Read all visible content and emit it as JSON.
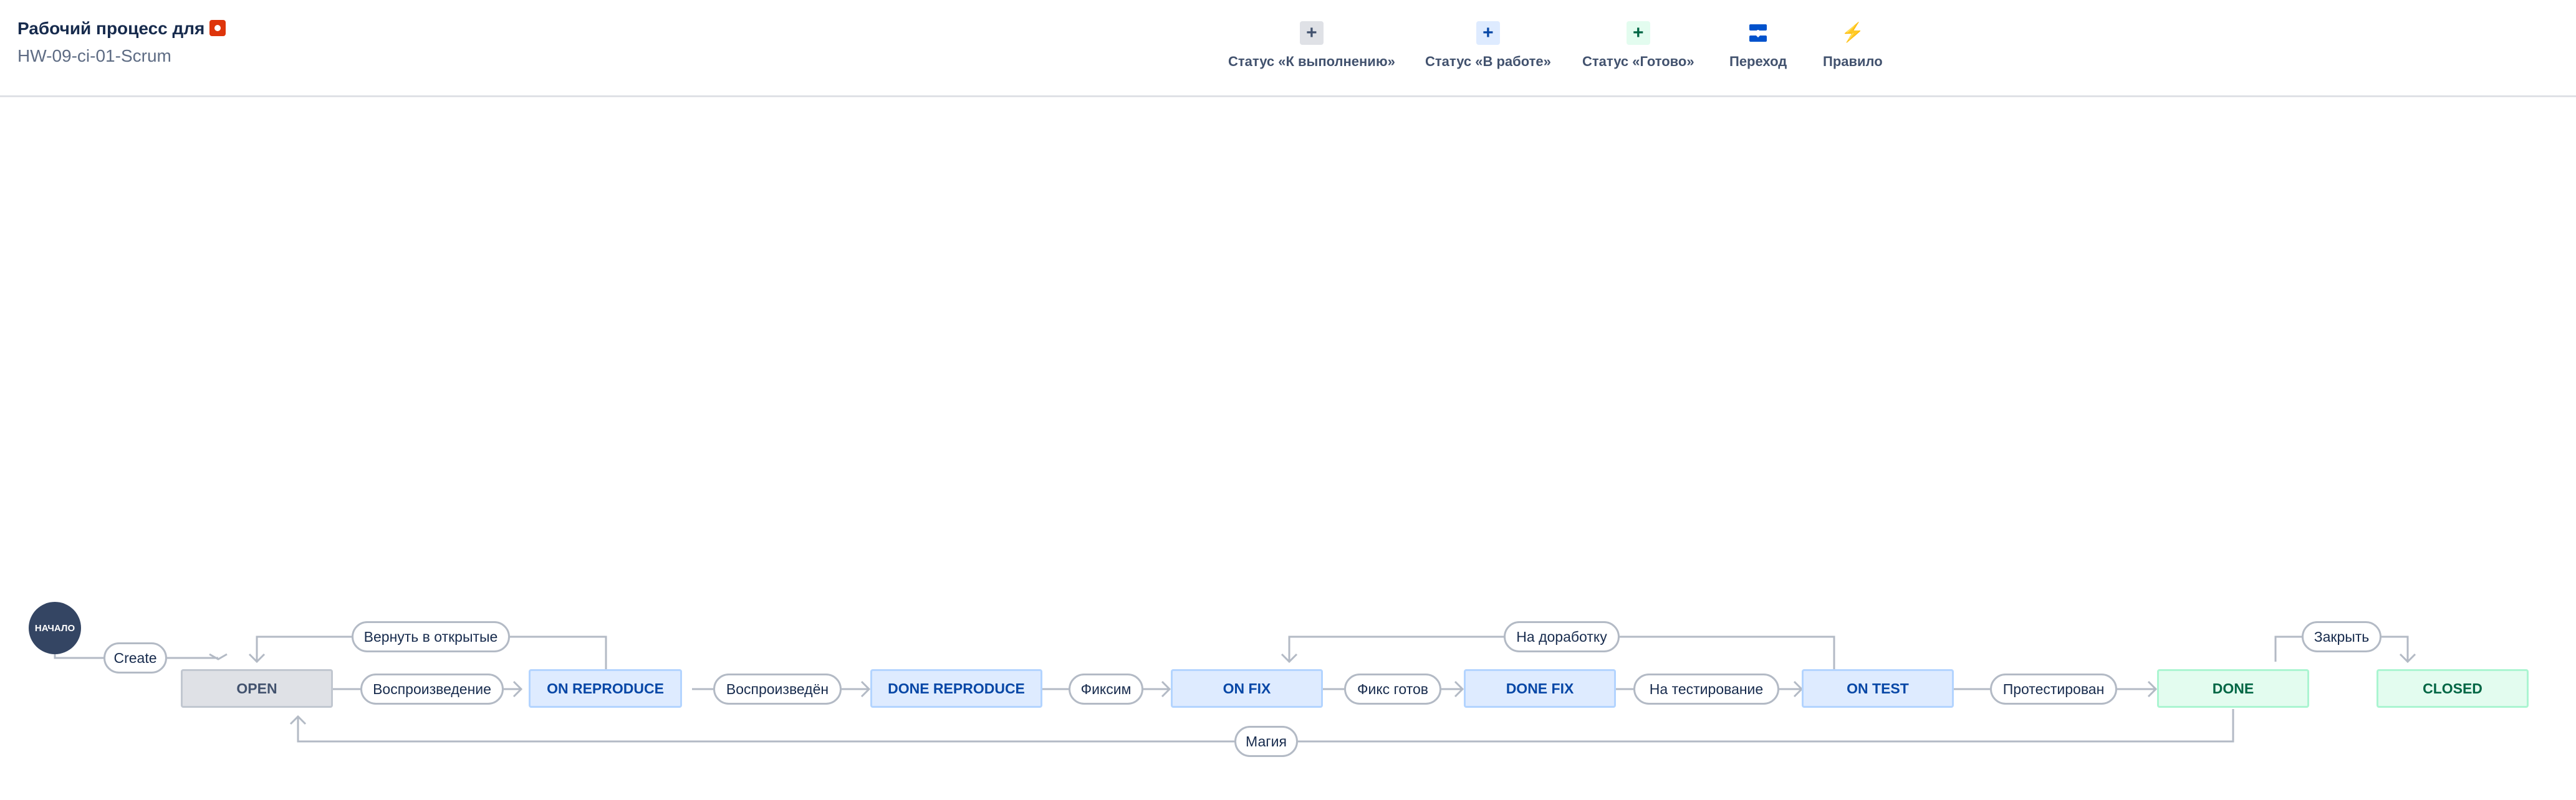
{
  "header": {
    "title": "Рабочий процесс для",
    "subtitle": "HW-09-ci-01-Scrum"
  },
  "toolbar": [
    {
      "label": "Статус «К выполнению»",
      "icon": "plus-icon",
      "glyph": "+"
    },
    {
      "label": "Статус «В работе»",
      "icon": "plus-icon",
      "glyph": "+"
    },
    {
      "label": "Статус «Готово»",
      "icon": "plus-icon",
      "glyph": "+"
    },
    {
      "label": "Переход",
      "icon": "transition-icon",
      "glyph": ""
    },
    {
      "label": "Правило",
      "icon": "lightning-icon",
      "glyph": "⚡"
    }
  ],
  "start_node": {
    "label": "НАЧАЛО"
  },
  "statuses": [
    {
      "label": "OPEN",
      "category": "todo"
    },
    {
      "label": "ON REPRODUCE",
      "category": "in-progress"
    },
    {
      "label": "DONE REPRODUCE",
      "category": "in-progress"
    },
    {
      "label": "ON FIX",
      "category": "in-progress"
    },
    {
      "label": "DONE FIX",
      "category": "in-progress"
    },
    {
      "label": "ON TEST",
      "category": "in-progress"
    },
    {
      "label": "DONE",
      "category": "done"
    },
    {
      "label": "CLOSED",
      "category": "done"
    }
  ],
  "transitions": [
    {
      "label": "Create"
    },
    {
      "label": "Воспроизведение"
    },
    {
      "label": "Воспроизведён"
    },
    {
      "label": "Фиксим"
    },
    {
      "label": "Фикс готов"
    },
    {
      "label": "На тестирование"
    },
    {
      "label": "Протестирован"
    },
    {
      "label": "Вернуть в открытые"
    },
    {
      "label": "На доработку"
    },
    {
      "label": "Закрыть"
    },
    {
      "label": "Магия"
    }
  ],
  "colors": {
    "todo": "#dfe1e6",
    "in_progress": "#deebff",
    "done": "#e3fcef",
    "connector": "#b3bac5",
    "start_node": "#344563",
    "badge": "#de350b"
  }
}
